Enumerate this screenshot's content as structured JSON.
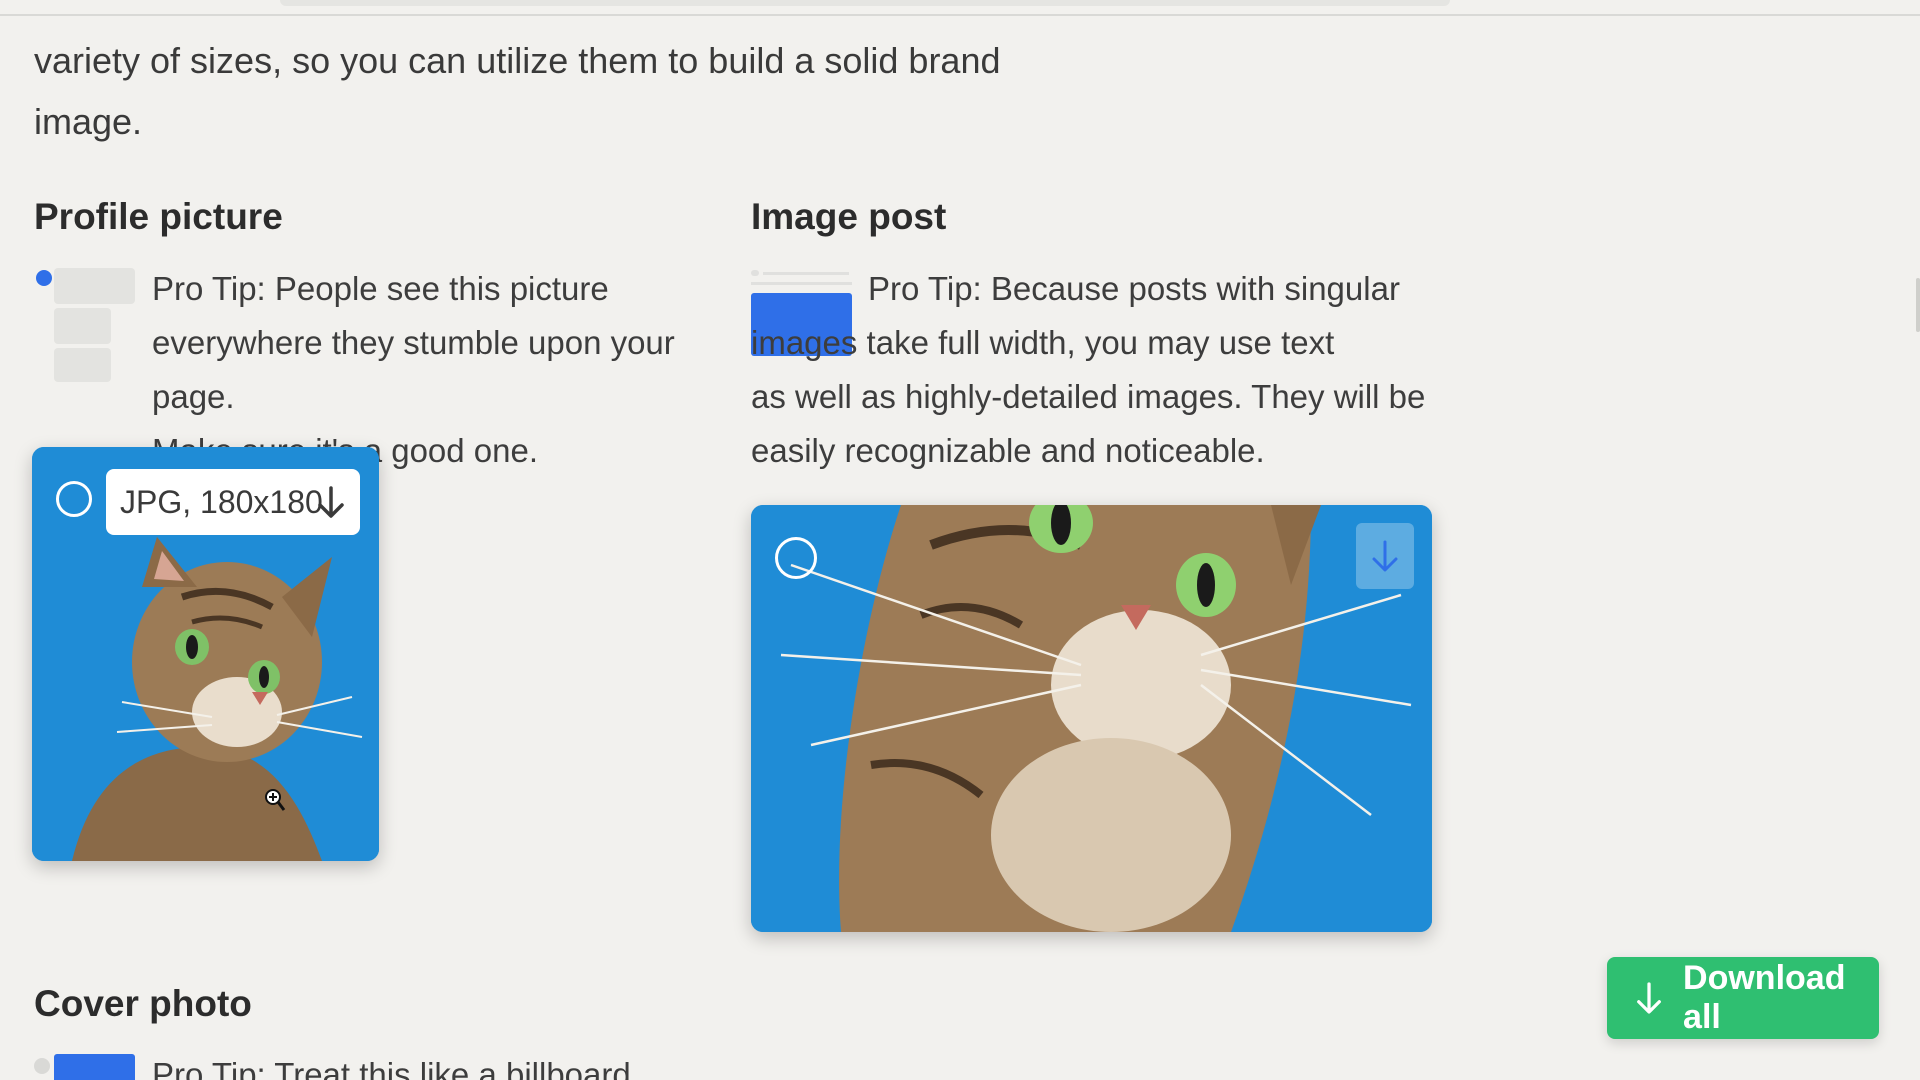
{
  "intro": {
    "line1": "variety of sizes, so you can utilize them to build a solid brand",
    "line2": "image."
  },
  "profile_picture": {
    "heading": "Profile picture",
    "tip_line1": "Pro Tip: People see this picture",
    "tip_line2": "everywhere they stumble upon your page.",
    "tip_line3": "Make sure it's a good one.",
    "format_label": "JPG, 180x180"
  },
  "image_post": {
    "heading": "Image post",
    "tip_line1": "Pro Tip: Because posts with singular",
    "tip_line2": "images take full width, you may use text",
    "tip_line3": "as well as highly-detailed images. They will be",
    "tip_line4": "easily recognizable and noticeable."
  },
  "cover_photo": {
    "heading": "Cover photo",
    "tip_partial": "Pro Tip: Treat this like a billboard"
  },
  "download_all": {
    "label": "Download all",
    "color": "#2fbf71"
  },
  "colors": {
    "accent_blue": "#2f6fe8",
    "photo_sky": "#1e8ad4",
    "background": "#f2f1ee"
  },
  "icons": {
    "download": "arrow-down-icon",
    "select": "radio-circle-icon",
    "zoom": "zoom-in-cursor-icon"
  }
}
